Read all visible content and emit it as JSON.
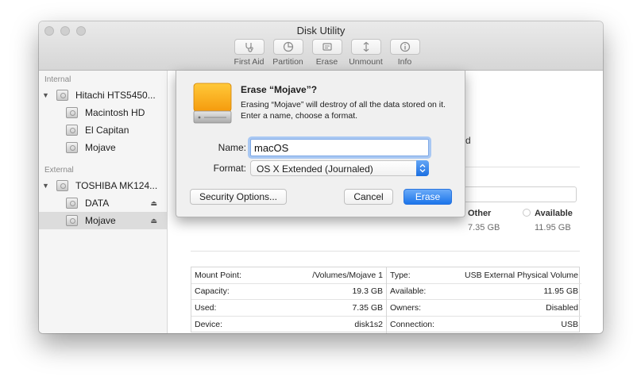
{
  "window": {
    "title": "Disk Utility"
  },
  "toolbar": {
    "items": [
      {
        "label": "First Aid",
        "icon": "stethoscope-icon"
      },
      {
        "label": "Partition",
        "icon": "pie-icon"
      },
      {
        "label": "Erase",
        "icon": "eraser-icon"
      },
      {
        "label": "Unmount",
        "icon": "unmount-icon"
      },
      {
        "label": "Info",
        "icon": "info-icon"
      }
    ]
  },
  "sidebar": {
    "internal_header": "Internal",
    "external_header": "External",
    "internal": [
      {
        "label": "Hitachi HTS5450...",
        "level": 0
      },
      {
        "label": "Macintosh HD",
        "level": 1
      },
      {
        "label": "El Capitan",
        "level": 1
      },
      {
        "label": "Mojave",
        "level": 1
      }
    ],
    "external": [
      {
        "label": "TOSHIBA MK124...",
        "level": 0
      },
      {
        "label": "DATA",
        "level": 1
      },
      {
        "label": "Mojave",
        "level": 1,
        "selected": true
      }
    ]
  },
  "main": {
    "partial_d": "d",
    "other_label": "Other",
    "other_value": "7.35 GB",
    "available_label": "Available",
    "available_value": "11.95 GB"
  },
  "info": {
    "left": [
      {
        "key": "Mount Point:",
        "value": "/Volumes/Mojave 1"
      },
      {
        "key": "Capacity:",
        "value": "19.3 GB"
      },
      {
        "key": "Used:",
        "value": "7.35 GB"
      },
      {
        "key": "Device:",
        "value": "disk1s2"
      }
    ],
    "right": [
      {
        "key": "Type:",
        "value": "USB External Physical Volume"
      },
      {
        "key": "Available:",
        "value": "11.95 GB"
      },
      {
        "key": "Owners:",
        "value": "Disabled"
      },
      {
        "key": "Connection:",
        "value": "USB"
      }
    ]
  },
  "sheet": {
    "title": "Erase “Mojave”?",
    "description": "Erasing “Mojave” will destroy of all the data stored on it. Enter a name, choose a format.",
    "name_label": "Name:",
    "name_value": "macOS",
    "format_label": "Format:",
    "format_value": "OS X Extended (Journaled)",
    "security_button": "Security Options...",
    "cancel_button": "Cancel",
    "erase_button": "Erase",
    "accent": "#1c74ea"
  }
}
